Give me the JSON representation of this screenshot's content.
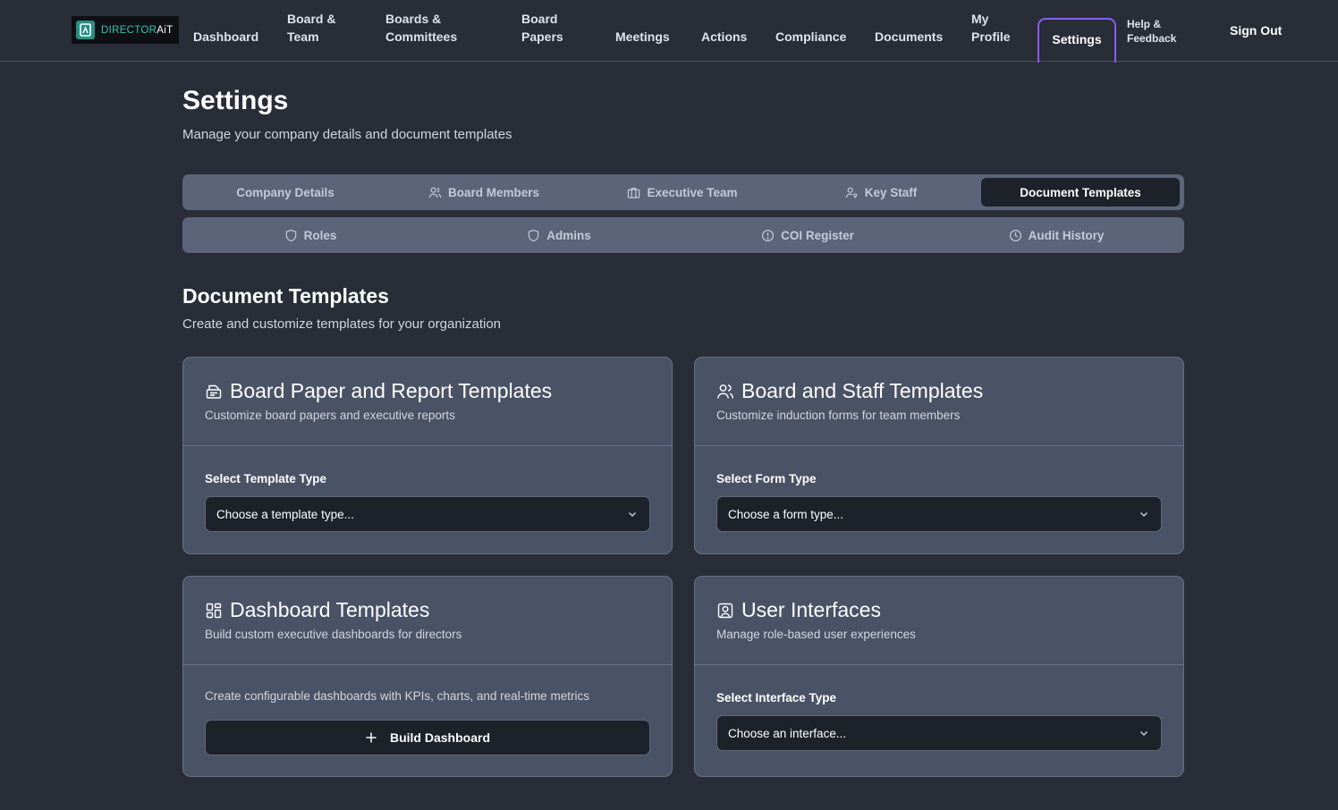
{
  "brand": {
    "part1": "DIRECTOR",
    "part2": "AiT"
  },
  "nav": {
    "dashboard": "Dashboard",
    "board_team": [
      "Board &",
      "Team"
    ],
    "boards_committees": [
      "Boards &",
      "Committees"
    ],
    "board_papers": [
      "Board",
      "Papers"
    ],
    "meetings": "Meetings",
    "actions": "Actions",
    "compliance": "Compliance",
    "documents": "Documents",
    "my_profile": [
      "My",
      "Profile"
    ],
    "settings": "Settings",
    "help_feedback": [
      "Help &",
      "Feedback"
    ],
    "sign_out": "Sign Out"
  },
  "header": {
    "title": "Settings",
    "subtitle": "Manage your company details and document templates"
  },
  "tabs_primary": [
    {
      "label": "Company Details",
      "icon": "none"
    },
    {
      "label": "Board Members",
      "icon": "users-icon"
    },
    {
      "label": "Executive Team",
      "icon": "briefcase-icon"
    },
    {
      "label": "Key Staff",
      "icon": "user-key-icon"
    },
    {
      "label": "Document Templates",
      "icon": "none",
      "active": true
    }
  ],
  "tabs_secondary": [
    {
      "label": "Roles",
      "icon": "shield-icon"
    },
    {
      "label": "Admins",
      "icon": "shield-icon"
    },
    {
      "label": "COI Register",
      "icon": "alert-circle-icon"
    },
    {
      "label": "Audit History",
      "icon": "clock-icon"
    }
  ],
  "section": {
    "title": "Document Templates",
    "subtitle": "Create and customize templates for your organization"
  },
  "cards": {
    "board_paper": {
      "title": "Board Paper and Report Templates",
      "desc": "Customize board papers and executive reports",
      "label": "Select Template Type",
      "placeholder": "Choose a template type..."
    },
    "board_staff": {
      "title": "Board and Staff Templates",
      "desc": "Customize induction forms for team members",
      "label": "Select Form Type",
      "placeholder": "Choose a form type..."
    },
    "dashboard": {
      "title": "Dashboard Templates",
      "desc": "Build custom executive dashboards for directors",
      "text": "Create configurable dashboards with KPIs, charts, and real-time metrics",
      "button": "Build Dashboard"
    },
    "user_interfaces": {
      "title": "User Interfaces",
      "desc": "Manage role-based user experiences",
      "label": "Select Interface Type",
      "placeholder": "Choose an interface..."
    }
  },
  "colors": {
    "background": "#282d38",
    "card": "#4a5266",
    "tabbar": "#5b6479",
    "active_tab": "#1d2129",
    "settings_outline": "#8b5cf6",
    "brand_teal": "#39c2b2"
  }
}
